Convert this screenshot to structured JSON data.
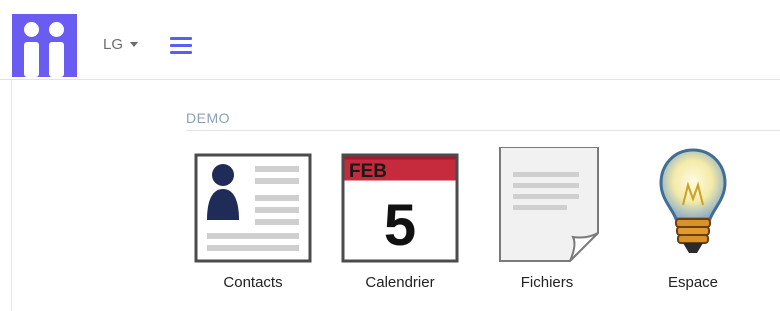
{
  "header": {
    "logo_name": "app-logo",
    "user_initials": "LG",
    "menu_icon": "hamburger-menu-icon",
    "accent_color": "#6a5cf0",
    "menu_color": "#5b5ff0"
  },
  "section": {
    "title": "DEMO"
  },
  "apps": [
    {
      "label": "Contacts",
      "icon": "contact-card-icon"
    },
    {
      "label": "Calendrier",
      "icon": "calendar-icon",
      "month": "FEB",
      "day": "5"
    },
    {
      "label": "Fichiers",
      "icon": "document-icon"
    },
    {
      "label": "Espace",
      "icon": "lightbulb-icon"
    }
  ]
}
